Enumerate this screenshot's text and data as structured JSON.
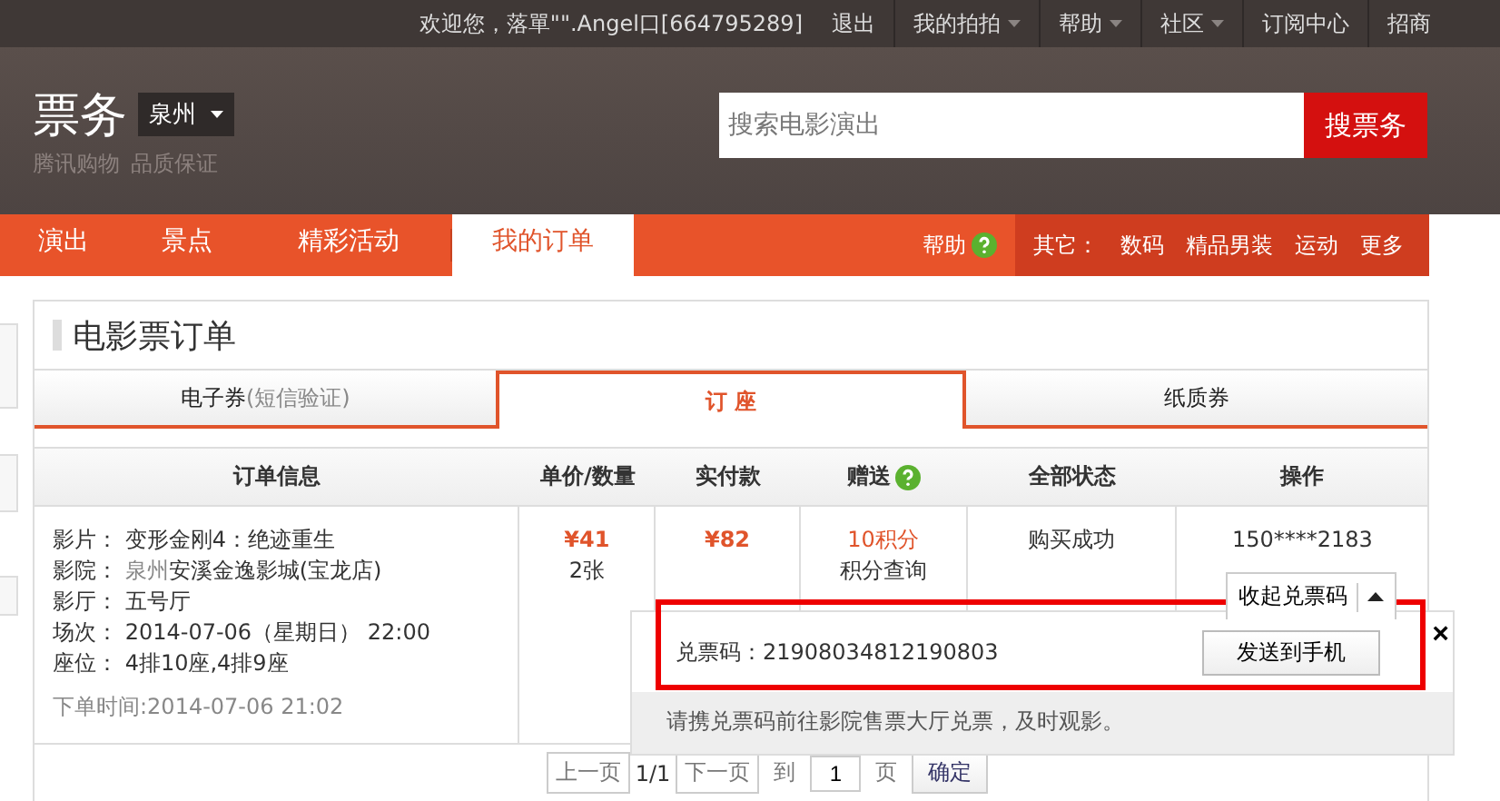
{
  "top_bar": {
    "welcome": "欢迎您，落單\"\".Angel口[664795289]",
    "links": [
      {
        "label": "退出",
        "dropdown": false
      },
      {
        "label": "我的拍拍",
        "dropdown": true
      },
      {
        "label": "帮助",
        "dropdown": true
      },
      {
        "label": "社区",
        "dropdown": true
      },
      {
        "label": "订阅中心",
        "dropdown": false
      },
      {
        "label": "招商",
        "dropdown": false
      }
    ]
  },
  "header": {
    "logo": "票务",
    "slogans": [
      "腾讯购物",
      "品质保证"
    ],
    "city": "泉州",
    "search": {
      "placeholder": "搜索电影演出"
    },
    "search_button": "搜票务"
  },
  "nav": {
    "tabs": [
      {
        "label": "演出",
        "selected": false
      },
      {
        "label": "景点",
        "selected": false
      },
      {
        "label": "精彩活动",
        "selected": false
      },
      {
        "label": "我的订单",
        "selected": true
      }
    ],
    "help": "帮助",
    "others_label": "其它：",
    "others": [
      "数码",
      "精品男装",
      "运动",
      "更多"
    ]
  },
  "card": {
    "title": "电影票订单",
    "tabs": [
      {
        "label": "电子券",
        "note": "(短信验证)",
        "selected": false
      },
      {
        "label": "订 座",
        "selected": true
      },
      {
        "label": "纸质券",
        "selected": false
      }
    ],
    "columns": [
      {
        "label": "订单信息"
      },
      {
        "label": "单价/数量"
      },
      {
        "label": "实付款"
      },
      {
        "label": "赠送",
        "help": true
      },
      {
        "label": "全部状态"
      },
      {
        "label": "操作"
      }
    ],
    "order": {
      "info": [
        {
          "label": "影片：",
          "value": "变形金刚4：绝迹重生"
        },
        {
          "label": "影院：",
          "city": "泉州",
          "value": "安溪金逸影城(宝龙店)"
        },
        {
          "label": "影厅：",
          "value": "五号厅"
        },
        {
          "label": "场次：",
          "value": "2014-07-06（星期日） 22:00"
        },
        {
          "label": "座位：",
          "value": "4排10座,4排9座"
        }
      ],
      "order_time": "下单时间:2014-07-06 21:02",
      "unit_price": "¥41",
      "quantity": "2张",
      "paid": "¥82",
      "gift": "10积分",
      "points_link": "积分查询",
      "status": "购买成功",
      "phone": "150****2183",
      "toggle_button": "收起兑票码"
    },
    "ticket_popup": {
      "code": "兑票码：21908034812190803",
      "send_button": "发送到手机",
      "close": "×",
      "note": "请携兑票码前往影院售票大厅兑票，及时观影。"
    },
    "pagination": {
      "prev": "上一页",
      "page": "1/1",
      "next": "下一页",
      "goto": "到",
      "page_input": "1",
      "page_unit": "页",
      "confirm": "确定"
    }
  }
}
